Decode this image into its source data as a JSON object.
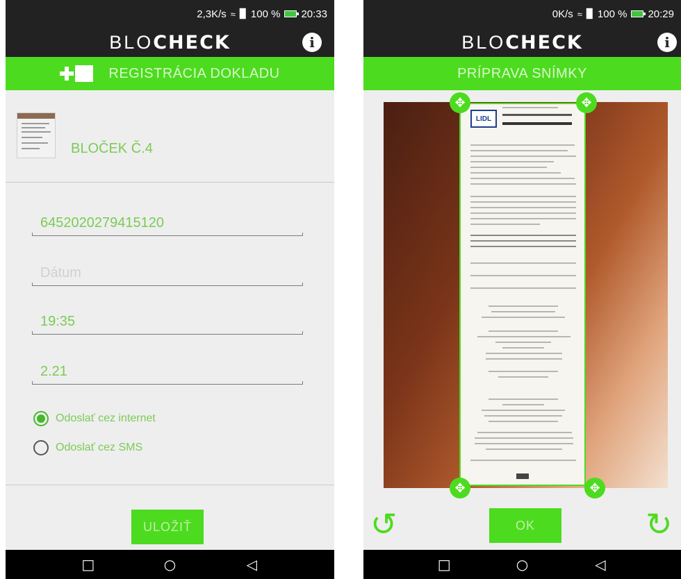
{
  "left_screen": {
    "status": {
      "speed": "2,3K/s",
      "battery": "100 %",
      "time": "20:33"
    },
    "app_title": {
      "light": "BLO",
      "bold": "CHECK"
    },
    "header": {
      "title": "REGISTRÁCIA DOKLADU"
    },
    "receipt": {
      "title": "BLOČEK Č.4"
    },
    "fields": {
      "receipt_number": "6452020279415120",
      "date_placeholder": "Dátum",
      "time": "19:35",
      "amount": "2.21"
    },
    "send_options": [
      {
        "label": "Odoslať cez internet",
        "selected": true
      },
      {
        "label": "Odoslať cez SMS",
        "selected": false
      }
    ],
    "save_button": "ULOŽIŤ"
  },
  "right_screen": {
    "status": {
      "speed": "0K/s",
      "battery": "100 %",
      "time": "20:29"
    },
    "app_title": {
      "light": "BLO",
      "bold": "CHECK"
    },
    "header": {
      "title": "PRÍPRAVA SNÍMKY"
    },
    "ok_button": "OK"
  },
  "colors": {
    "accent": "#4ddb1f",
    "dark_bar": "#222222",
    "label_green": "#7acb55",
    "background": "#eeeeee"
  },
  "icons": [
    "wifi-icon",
    "signal-icon",
    "battery-icon",
    "info-icon",
    "add-receipt-icon",
    "drag-handle-icon",
    "rotate-left-icon",
    "rotate-right-icon",
    "nav-recents-icon",
    "nav-home-icon",
    "nav-back-icon"
  ]
}
